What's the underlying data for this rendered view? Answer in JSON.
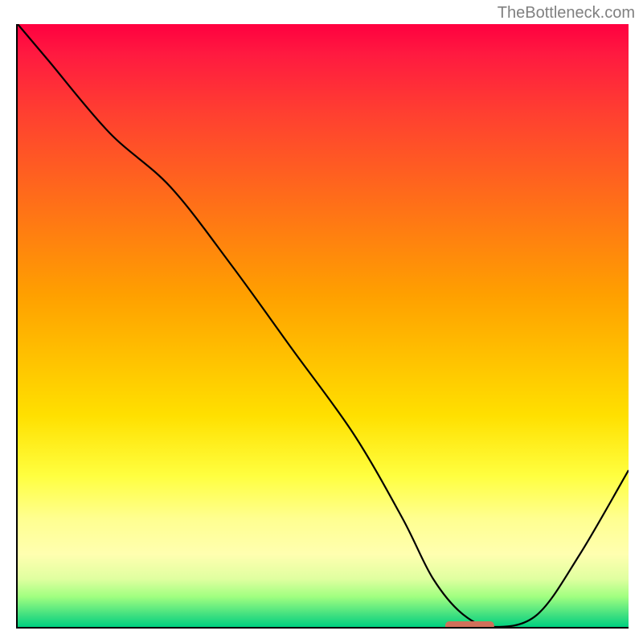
{
  "watermark": "TheBottleneck.com",
  "chart_data": {
    "type": "line",
    "title": "",
    "xlabel": "",
    "ylabel": "",
    "xlim": [
      0,
      100
    ],
    "ylim": [
      0,
      100
    ],
    "x": [
      0,
      5,
      15,
      25,
      35,
      45,
      55,
      63,
      68,
      73,
      78,
      85,
      92,
      100
    ],
    "values": [
      100,
      94,
      82,
      73,
      60,
      46,
      32,
      18,
      8,
      2,
      0,
      2,
      12,
      26
    ],
    "marker": {
      "x_range": [
        70,
        78
      ],
      "y": 0,
      "color": "#d0705a"
    },
    "gradient_stops": [
      {
        "pos": 0,
        "color": "#ff0040"
      },
      {
        "pos": 15,
        "color": "#ff4030"
      },
      {
        "pos": 35,
        "color": "#ff8010"
      },
      {
        "pos": 55,
        "color": "#ffc000"
      },
      {
        "pos": 75,
        "color": "#ffff40"
      },
      {
        "pos": 92,
        "color": "#e0ffa0"
      },
      {
        "pos": 100,
        "color": "#00d080"
      }
    ]
  }
}
